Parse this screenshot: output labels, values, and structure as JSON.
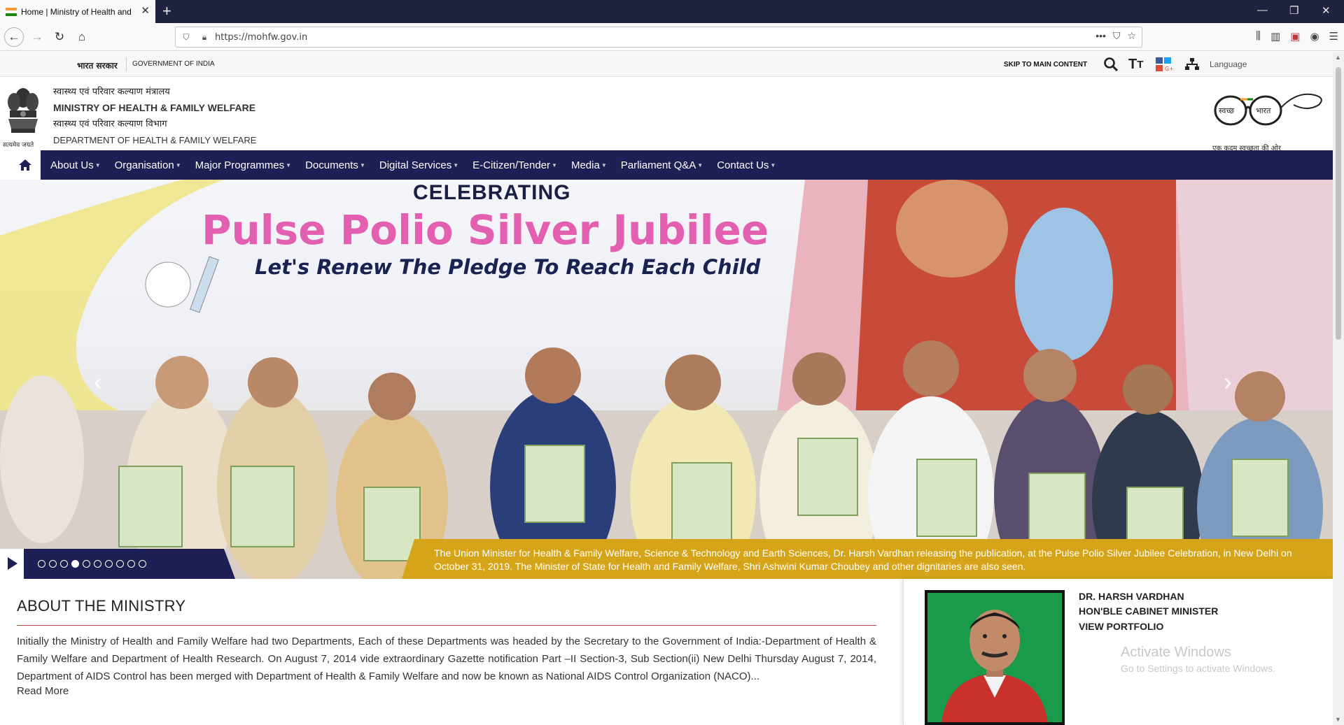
{
  "browser": {
    "tab_title": "Home | Ministry of Health and",
    "url": "https://mohfw.gov.in",
    "colors": {
      "tabbar": "#202340",
      "toolbar": "#f9f9fa"
    }
  },
  "govbar": {
    "hindi": "भारत सरकार",
    "english": "GOVERNMENT OF INDIA",
    "skip": "SKIP TO MAIN CONTENT",
    "language": "Language"
  },
  "header": {
    "emblem_caption": "सत्यमेव जयते",
    "ministry_hindi": "स्वास्थ्य एवं परिवार कल्याण मंत्रालय",
    "ministry_english": "MINISTRY OF HEALTH & FAMILY WELFARE",
    "dept_hindi": "स्वास्थ्य एवं परिवार कल्याण विभाग",
    "dept_english": "DEPARTMENT OF HEALTH & FAMILY WELFARE",
    "swachh_left": "स्वच्छ",
    "swachh_right": "भारत",
    "swachh_caption": "एक कदम स्वच्छता की ओर"
  },
  "nav": {
    "items": [
      {
        "label": "About Us"
      },
      {
        "label": "Organisation"
      },
      {
        "label": "Major Programmes"
      },
      {
        "label": "Documents"
      },
      {
        "label": "Digital Services"
      },
      {
        "label": "E-Citizen/Tender"
      },
      {
        "label": "Media"
      },
      {
        "label": "Parliament Q&A"
      },
      {
        "label": "Contact Us"
      }
    ],
    "color": "#1e1f55"
  },
  "slider": {
    "line1": "CELEBRATING",
    "line2": "Pulse Polio Silver Jubilee",
    "line3": "Let's Renew The Pledge To Reach Each Child",
    "caption": "The Union Minister for Health & Family Welfare, Science & Technology and Earth Sciences, Dr. Harsh Vardhan releasing the publication, at the Pulse Polio Silver Jubilee Celebration, in New Delhi on October 31, 2019. The Minister of State for Health and Family Welfare, Shri Ashwini Kumar Choubey and other dignitaries are also seen.",
    "dot_count": 10,
    "active_dot": 4,
    "caption_color": "#d6a418"
  },
  "about": {
    "title": "ABOUT THE MINISTRY",
    "text": "Initially the Ministry of Health and Family Welfare had two Departments, Each of these Departments was headed by the Secretary to the Government of India:-Department of Health & Family Welfare and Department of Health Research. On August 7, 2014 vide extraordinary Gazette notification Part –II Section-3, Sub Section(ii) New Delhi Thursday August 7, 2014, Department of AIDS Control has been merged with Department of Health & Family Welfare and now be known as National AIDS Control Organization (NACO)...",
    "read_more": "Read More"
  },
  "minister": {
    "name": "DR. HARSH VARDHAN",
    "role": "HON'BLE CABINET MINISTER",
    "link": "VIEW PORTFOLIO"
  },
  "watermark": {
    "line1": "Activate Windows",
    "line2": "Go to Settings to activate Windows."
  }
}
